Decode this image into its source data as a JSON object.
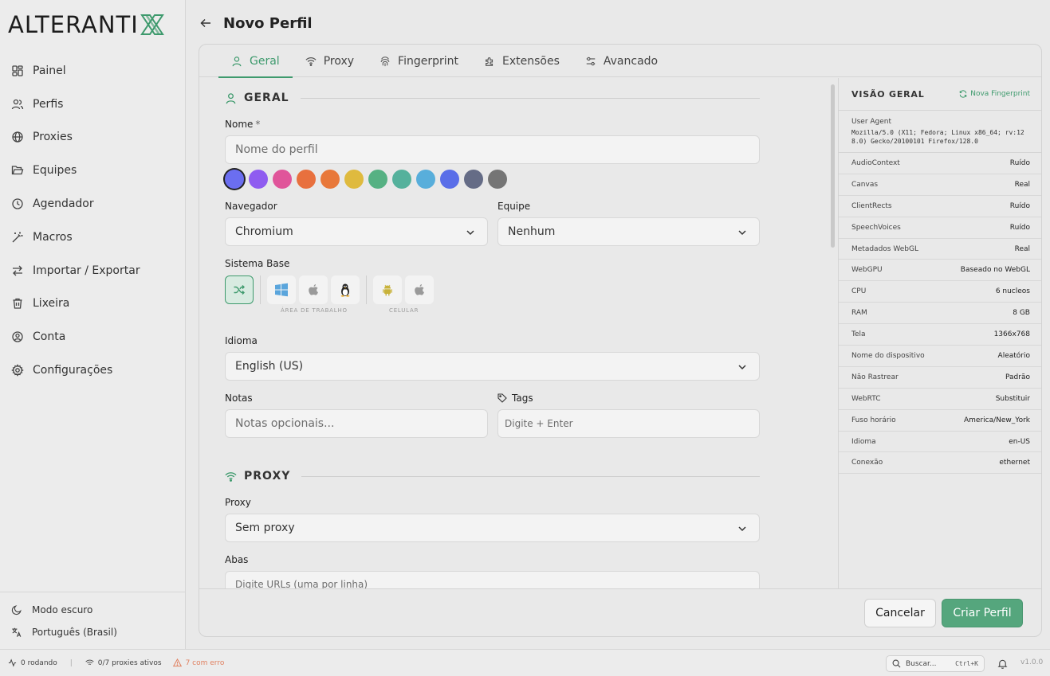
{
  "brand": {
    "logo_text": "ALTERANTI"
  },
  "colors": {
    "accent": "#3e9a6d",
    "error": "#e08060"
  },
  "sidebar": {
    "items": [
      {
        "label": "Painel",
        "icon": "dashboard-icon"
      },
      {
        "label": "Perfis",
        "icon": "users-icon"
      },
      {
        "label": "Proxies",
        "icon": "globe-icon"
      },
      {
        "label": "Equipes",
        "icon": "folder-icon"
      },
      {
        "label": "Agendador",
        "icon": "clock-icon"
      },
      {
        "label": "Macros",
        "icon": "wand-icon"
      },
      {
        "label": "Importar / Exportar",
        "icon": "arrows-icon"
      },
      {
        "label": "Lixeira",
        "icon": "trash-icon"
      },
      {
        "label": "Conta",
        "icon": "user-circle-icon"
      },
      {
        "label": "Configurações",
        "icon": "gear-icon"
      }
    ],
    "bottom": {
      "dark_mode": "Modo escuro",
      "language": "Português (Brasil)"
    }
  },
  "header": {
    "title": "Novo Perfil"
  },
  "tabs": [
    {
      "label": "Geral",
      "active": true
    },
    {
      "label": "Proxy"
    },
    {
      "label": "Fingerprint"
    },
    {
      "label": "Extensões"
    },
    {
      "label": "Avancado"
    }
  ],
  "form": {
    "geral_title": "GERAL",
    "name_label": "Nome",
    "name_required": "*",
    "name_placeholder": "Nome do perfil",
    "swatch_colors": [
      "#6b6ef0",
      "#8f5cf0",
      "#e0559a",
      "#e8703e",
      "#e8783a",
      "#dfba3e",
      "#56b183",
      "#55b19c",
      "#58aedb",
      "#5a6ee8",
      "#656c86",
      "#757575"
    ],
    "browser_label": "Navegador",
    "browser_value": "Chromium",
    "team_label": "Equipe",
    "team_value": "Nenhum",
    "base_os_label": "Sistema Base",
    "desktop_caption": "ÁREA DE TRABALHO",
    "mobile_caption": "CELULAR",
    "language_label": "Idioma",
    "language_value": "English (US)",
    "notes_label": "Notas",
    "notes_placeholder": "Notas opcionais...",
    "tags_label": "Tags",
    "tags_placeholder": "Digite + Enter",
    "proxy_title": "PROXY",
    "proxy_label": "Proxy",
    "proxy_value": "Sem proxy",
    "tabs_label": "Abas",
    "tabs_placeholder": "Digite URLs (uma por linha)"
  },
  "overview": {
    "title": "VISÃO GERAL",
    "refresh_label": "Nova Fingerprint",
    "ua_label": "User Agent",
    "ua_value": "Mozilla/5.0 (X11; Fedora; Linux x86_64; rv:128.0) Gecko/20100101 Firefox/128.0",
    "rows": [
      {
        "k": "AudioContext",
        "v": "Ruído"
      },
      {
        "k": "Canvas",
        "v": "Real"
      },
      {
        "k": "ClientRects",
        "v": "Ruído"
      },
      {
        "k": "SpeechVoices",
        "v": "Ruído"
      },
      {
        "k": "Metadados WebGL",
        "v": "Real"
      },
      {
        "k": "WebGPU",
        "v": "Baseado no WebGL"
      },
      {
        "k": "CPU",
        "v": "6 nucleos"
      },
      {
        "k": "RAM",
        "v": "8 GB"
      },
      {
        "k": "Tela",
        "v": "1366x768"
      },
      {
        "k": "Nome do dispositivo",
        "v": "Aleatório"
      },
      {
        "k": "Não Rastrear",
        "v": "Padrão"
      },
      {
        "k": "WebRTC",
        "v": "Substituir"
      },
      {
        "k": "Fuso horário",
        "v": "America/New_York"
      },
      {
        "k": "Idioma",
        "v": "en-US"
      },
      {
        "k": "Conexão",
        "v": "ethernet"
      }
    ]
  },
  "footer": {
    "cancel": "Cancelar",
    "create": "Criar Perfil"
  },
  "status": {
    "running": "0 rodando",
    "proxies": "0/7 proxies ativos",
    "errors": "7 com erro",
    "search": "Buscar...",
    "shortcut": "Ctrl+K",
    "version": "v1.0.0"
  }
}
